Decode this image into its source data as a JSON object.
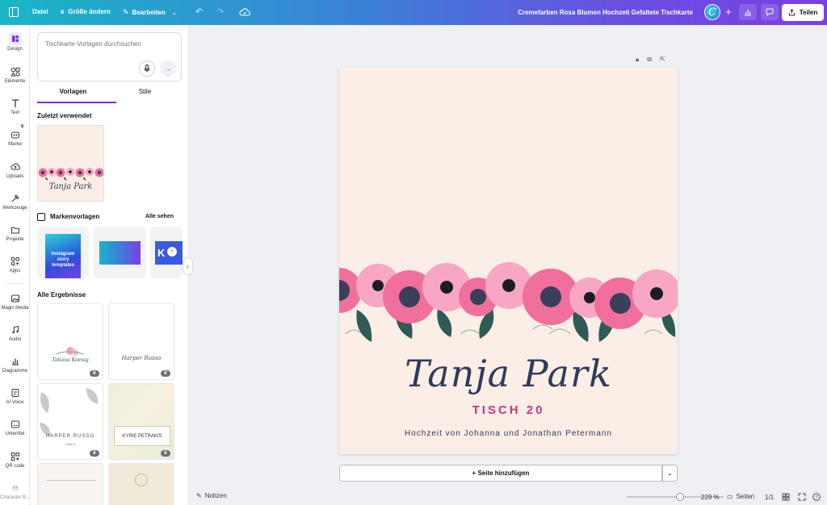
{
  "topbar": {
    "file": "Datei",
    "resize": "Größe ändern",
    "edit": "Bearbeiten",
    "doc_title": "Cremefarben Rosa Blumen Hochzeit Gefaltete Tischkarte",
    "share": "Teilen",
    "avatar_letter": "C"
  },
  "rail": [
    {
      "label": "Design",
      "icon": "design-icon"
    },
    {
      "label": "Elemente",
      "icon": "elements-icon"
    },
    {
      "label": "Text",
      "icon": "text-icon"
    },
    {
      "label": "Marke",
      "icon": "brand-icon"
    },
    {
      "label": "Uploads",
      "icon": "upload-icon"
    },
    {
      "label": "Werkzeuge",
      "icon": "tools-icon"
    },
    {
      "label": "Projekte",
      "icon": "folder-icon"
    },
    {
      "label": "Apps",
      "icon": "apps-icon"
    },
    {
      "label": "Magic Media",
      "icon": "magic-media-icon"
    },
    {
      "label": "Audio",
      "icon": "audio-icon"
    },
    {
      "label": "Diagramme",
      "icon": "charts-icon"
    },
    {
      "label": "AI Voice",
      "icon": "ai-voice-icon"
    },
    {
      "label": "Untertitel",
      "icon": "subtitles-icon"
    },
    {
      "label": "QR code",
      "icon": "qr-icon"
    },
    {
      "label": "Character B...",
      "icon": "character-icon"
    }
  ],
  "panel": {
    "search_placeholder": "Tischkarte-Vorlagen durchsuchen",
    "tab_templates": "Vorlagen",
    "tab_styles": "Stile",
    "recent_title": "Zuletzt verwendet",
    "brand_title": "Markenvorlagen",
    "see_all": "Alle sehen",
    "all_results_title": "Alle Ergebnisse",
    "recent_thumb_name": "Tanja Park",
    "brand_card1_line1": "Instagram",
    "brand_card1_line2": "story",
    "brand_card1_line3": "templates",
    "results": [
      {
        "title": "Tatiana Koenig"
      },
      {
        "title": "Harper Russo"
      },
      {
        "title": "HARPER RUSSO",
        "sub": "Table 8"
      },
      {
        "title": "KYRIE PETRAKIS"
      },
      {
        "title": ""
      },
      {
        "title": ""
      }
    ]
  },
  "canvas": {
    "name": "Tanja Park",
    "table": "TISCH 20",
    "subline": "Hochzeit von Johanna und Jonathan Petermann",
    "add_page": "+ Seite hinzufügen",
    "background_color": "#fbeee6",
    "accent_color": "#d4317a",
    "name_color": "#2f3a5c"
  },
  "bottombar": {
    "notes": "Notizen",
    "zoom": "229 %",
    "zoom_level": 229,
    "pages": "Seiten",
    "page_count": "1/1"
  }
}
